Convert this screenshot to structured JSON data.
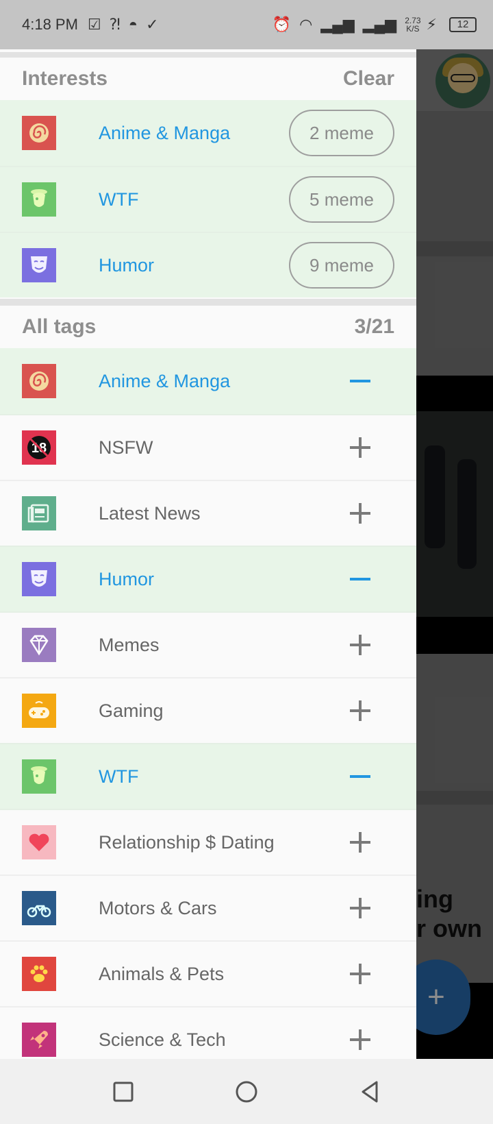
{
  "status_bar": {
    "time": "4:18 PM",
    "net_speed_value": "2.73",
    "net_speed_unit": "K/S",
    "battery": "12"
  },
  "interests": {
    "title": "Interests",
    "clear_label": "Clear",
    "items": [
      {
        "label": "Anime & Manga",
        "count": "2 meme",
        "icon": "spiral-icon",
        "color": "#d9534f"
      },
      {
        "label": "WTF",
        "count": "5 meme",
        "icon": "alien-icon",
        "color": "#6cc56a"
      },
      {
        "label": "Humor",
        "count": "9 meme",
        "icon": "mask-icon",
        "color": "#7b6fe0"
      }
    ]
  },
  "all_tags": {
    "title": "All tags",
    "count": "3/21",
    "items": [
      {
        "label": "Anime & Manga",
        "selected": true,
        "icon": "spiral-icon",
        "color": "#d9534f"
      },
      {
        "label": "NSFW",
        "selected": false,
        "icon": "nsfw-18-icon",
        "color": "#e0334f"
      },
      {
        "label": "Latest News",
        "selected": false,
        "icon": "newspaper-icon",
        "color": "#5fae8c"
      },
      {
        "label": "Humor",
        "selected": true,
        "icon": "mask-icon",
        "color": "#7b6fe0"
      },
      {
        "label": "Memes",
        "selected": false,
        "icon": "diamond-icon",
        "color": "#9a7cc0"
      },
      {
        "label": "Gaming",
        "selected": false,
        "icon": "gamepad-icon",
        "color": "#f4a812"
      },
      {
        "label": "WTF",
        "selected": true,
        "icon": "alien-icon",
        "color": "#6cc56a"
      },
      {
        "label": "Relationship $ Dating",
        "selected": false,
        "icon": "heart-icon",
        "color": "#f7b8c0"
      },
      {
        "label": "Motors & Cars",
        "selected": false,
        "icon": "motorbike-icon",
        "color": "#2a5a8a"
      },
      {
        "label": "Animals & Pets",
        "selected": false,
        "icon": "paw-icon",
        "color": "#e0463e"
      },
      {
        "label": "Science & Tech",
        "selected": false,
        "icon": "rocket-icon",
        "color": "#c2337a"
      }
    ]
  },
  "background": {
    "headline_line1": "ing",
    "headline_line2": "r own"
  }
}
